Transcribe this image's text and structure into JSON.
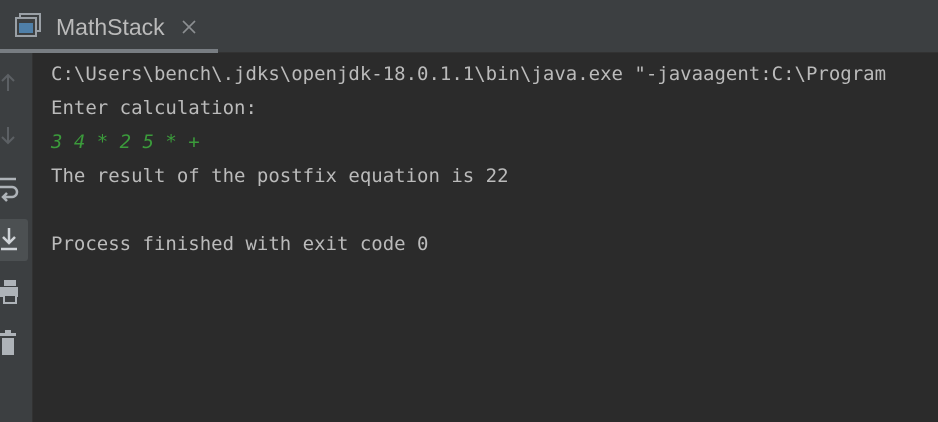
{
  "tab": {
    "title": "MathStack",
    "icon": "console-window-icon",
    "close_icon": "close-icon"
  },
  "sidebar": {
    "items": [
      {
        "name": "scroll-up-icon",
        "label": "Up"
      },
      {
        "name": "scroll-down-icon",
        "label": "Down"
      },
      {
        "name": "soft-wrap-icon",
        "label": "Soft-Wrap"
      },
      {
        "name": "scroll-to-end-icon",
        "label": "Scroll to End"
      },
      {
        "name": "print-icon",
        "label": "Print"
      },
      {
        "name": "trash-icon",
        "label": "Clear All"
      }
    ]
  },
  "console": {
    "lines": [
      {
        "text": "C:\\Users\\bench\\.jdks\\openjdk-18.0.1.1\\bin\\java.exe \"-javaagent:C:\\Program",
        "kind": "output"
      },
      {
        "text": "Enter calculation:",
        "kind": "output"
      },
      {
        "text": "3 4 * 2 5 * +",
        "kind": "input"
      },
      {
        "text": "The result of the postfix equation is 22",
        "kind": "output"
      },
      {
        "text": "",
        "kind": "output"
      },
      {
        "text": "Process finished with exit code 0",
        "kind": "output"
      }
    ]
  },
  "colors": {
    "background": "#2b2b2b",
    "panel": "#3c3f41",
    "text": "#bbbbbb",
    "user_input": "#3b9b3b"
  }
}
